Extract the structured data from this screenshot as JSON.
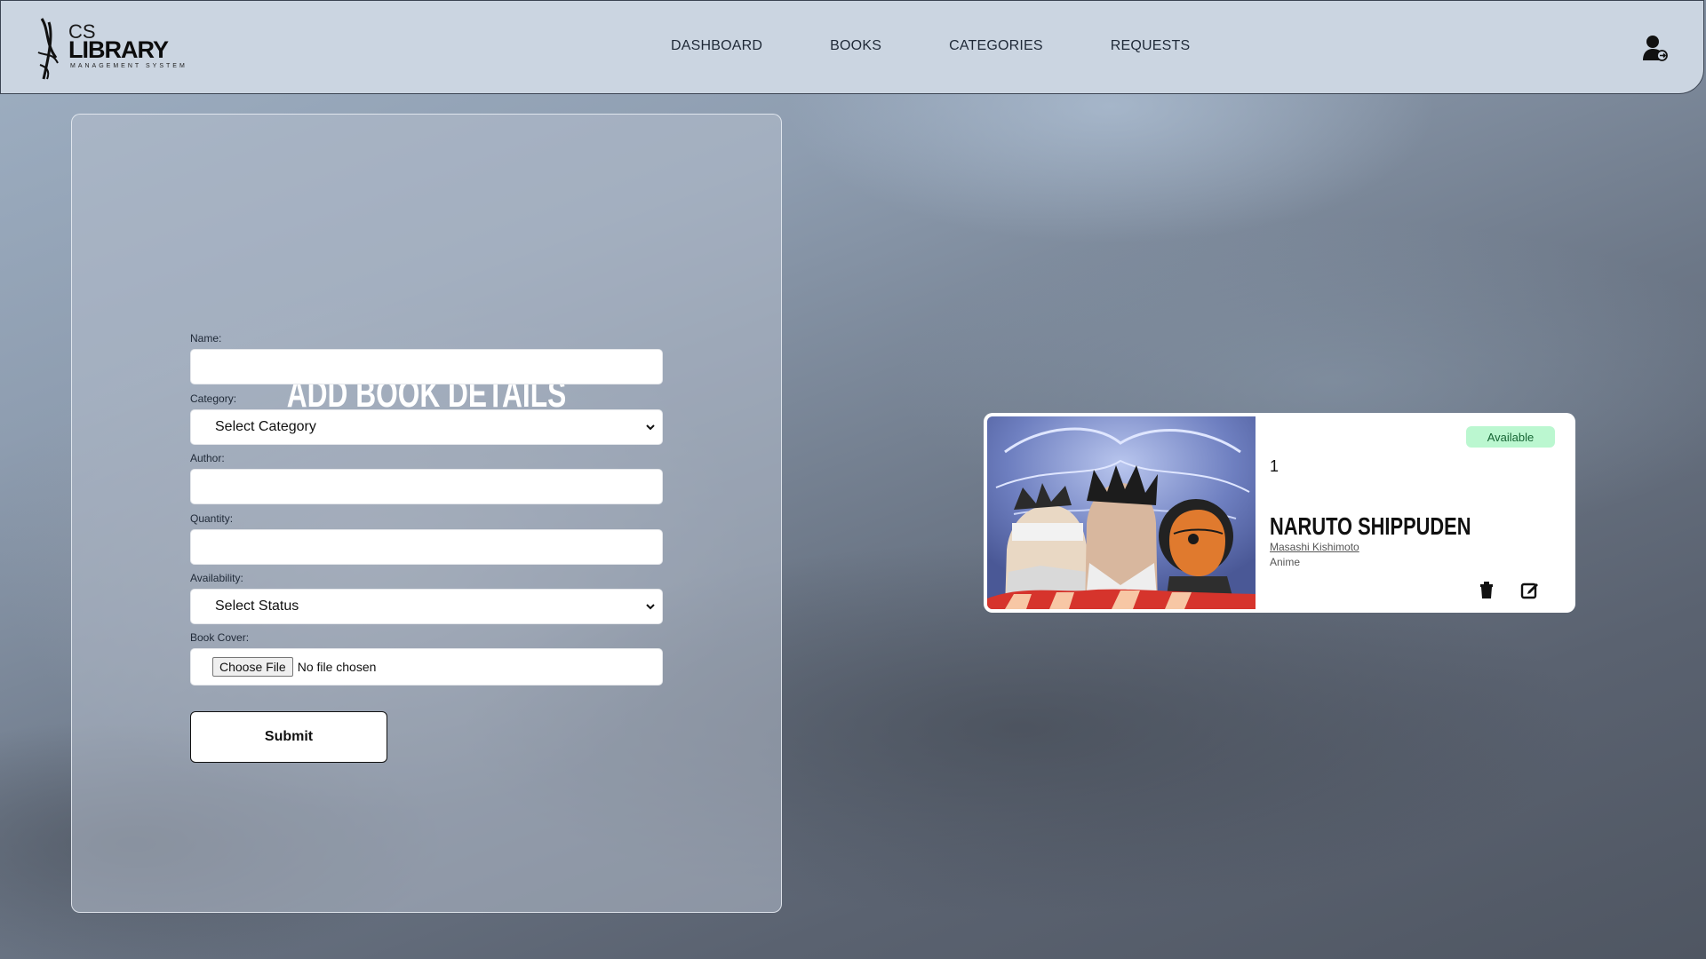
{
  "header": {
    "logo": {
      "top": "CS",
      "main": "LIBRARY",
      "sub": "MANAGEMENT SYSTEM"
    },
    "nav": [
      {
        "label": "DASHBOARD"
      },
      {
        "label": "BOOKS"
      },
      {
        "label": "CATEGORIES"
      },
      {
        "label": "REQUESTS"
      }
    ],
    "user_icon": "user-logout-icon"
  },
  "form": {
    "title": "ADD BOOK DETAILS",
    "name": {
      "label": "Name:",
      "value": ""
    },
    "category": {
      "label": "Category:",
      "selected": "Select Category"
    },
    "author": {
      "label": "Author:",
      "value": ""
    },
    "quantity": {
      "label": "Quantity:",
      "value": ""
    },
    "availability": {
      "label": "Availability:",
      "selected": "Select Status"
    },
    "cover": {
      "label": "Book Cover:",
      "button": "Choose File",
      "status": "No file chosen"
    },
    "submit": "Submit"
  },
  "book_card": {
    "status": "Available",
    "quantity": "1",
    "title": "NARUTO SHIPPUDEN",
    "author": "Masashi Kishimoto",
    "category": "Anime",
    "status_color": "#bbf7d0",
    "icons": [
      "trash-icon",
      "edit-icon"
    ]
  }
}
